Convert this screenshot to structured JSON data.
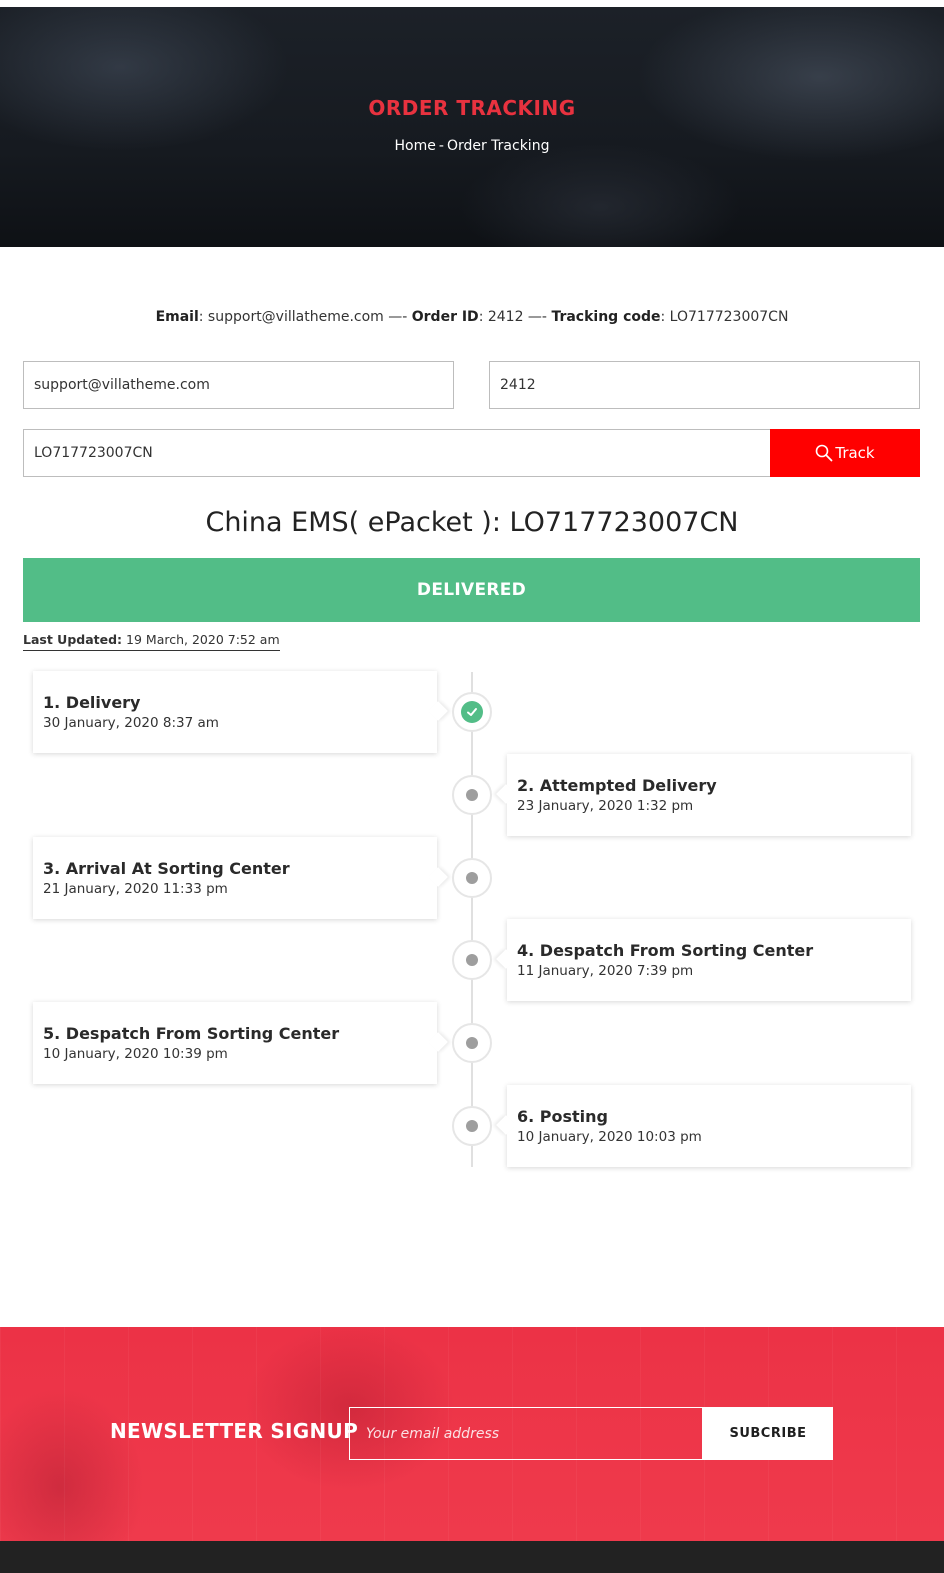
{
  "hero": {
    "title": "ORDER TRACKING",
    "breadcrumb": {
      "home": "Home",
      "separator": "-",
      "current": "Order Tracking"
    }
  },
  "summary": {
    "email_label": "Email",
    "email_value": ": support@villatheme.com",
    "sep1": " —- ",
    "order_label": "Order ID",
    "order_value": ": 2412",
    "sep2": " —- ",
    "tracking_label": "Tracking code",
    "tracking_value": ": LO717723007CN"
  },
  "form": {
    "email_value": "support@villatheme.com",
    "order_value": "2412",
    "tracking_value": "LO717723007CN",
    "track_label": "Track"
  },
  "carrier": "China EMS( ePacket ): LO717723007CN",
  "status": {
    "label": "DELIVERED",
    "color": "#52bd87"
  },
  "last_updated": {
    "label": "Last Updated:",
    "value": " 19 March, 2020 7:52 am"
  },
  "timeline": [
    {
      "title": "1. Delivery",
      "date": "30 January, 2020 8:37 am",
      "completed": true
    },
    {
      "title": "2. Attempted Delivery",
      "date": "23 January, 2020 1:32 pm",
      "completed": false
    },
    {
      "title": "3. Arrival At Sorting Center",
      "date": "21 January, 2020 11:33 pm",
      "completed": false
    },
    {
      "title": "4. Despatch From Sorting Center",
      "date": "11 January, 2020 7:39 pm",
      "completed": false
    },
    {
      "title": "5. Despatch From Sorting Center",
      "date": "10 January, 2020 10:39 pm",
      "completed": false
    },
    {
      "title": "6. Posting",
      "date": "10 January, 2020 10:03 pm",
      "completed": false
    }
  ],
  "newsletter": {
    "title": "NEWSLETTER SIGNUP",
    "placeholder": "Your email address",
    "button": "SUBCRIBE"
  },
  "colors": {
    "accent": "#e8323f",
    "track_button": "#ff0000",
    "newsletter_bg": "#ec3246",
    "success": "#52bd87"
  },
  "icons": {
    "search": "search-icon",
    "check": "check-icon"
  }
}
